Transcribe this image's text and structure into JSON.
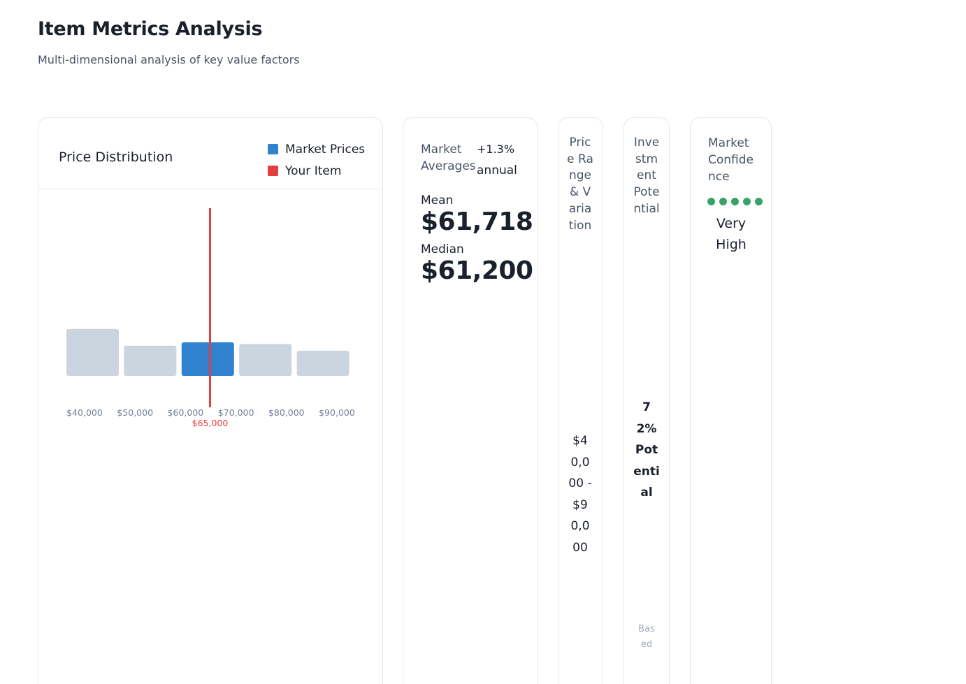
{
  "page": {
    "title": "Item Metrics Analysis",
    "subtitle": "Multi-dimensional analysis of key value factors"
  },
  "price_card": {
    "title": "Price Distribution",
    "legend": [
      {
        "label": "Market Prices",
        "color": "#3182ce"
      },
      {
        "label": "Your Item",
        "color": "#e53e3e"
      }
    ]
  },
  "chart_data": {
    "type": "bar",
    "title": "Price Distribution",
    "xlim": [
      40000,
      90000
    ],
    "x_ticks": [
      "$40,000",
      "$50,000",
      "$60,000",
      "$70,000",
      "$80,000",
      "$90,000"
    ],
    "bins": [
      {
        "from": 40000,
        "to": 50000,
        "value": 28,
        "highlight": false
      },
      {
        "from": 50000,
        "to": 60000,
        "value": 18,
        "highlight": false
      },
      {
        "from": 60000,
        "to": 70000,
        "value": 20,
        "highlight": true
      },
      {
        "from": 70000,
        "to": 80000,
        "value": 19,
        "highlight": false
      },
      {
        "from": 80000,
        "to": 90000,
        "value": 15,
        "highlight": false
      }
    ],
    "ylim": [
      0,
      100
    ],
    "marker": {
      "value": 65000,
      "label": "$65,000"
    },
    "colors": {
      "bar": "#cbd5e0",
      "highlight": "#3182ce",
      "marker": "#e53e3e",
      "tick": "#718096"
    },
    "grid": false
  },
  "averages": {
    "title": "Market Averages",
    "change_pct": "+1.3%",
    "change_period": "annual",
    "mean_label": "Mean",
    "mean_value": "$61,718",
    "median_label": "Median",
    "median_value": "$61,200"
  },
  "range": {
    "title": "Price Range & Variation",
    "value": "$40,000 - $90,000"
  },
  "investment": {
    "title": "Investment Potential",
    "value": "72% Potential",
    "note": "Based"
  },
  "confidence": {
    "title": "Market Confidence",
    "level": "Very High",
    "rating": 5,
    "color": "#38a169"
  }
}
